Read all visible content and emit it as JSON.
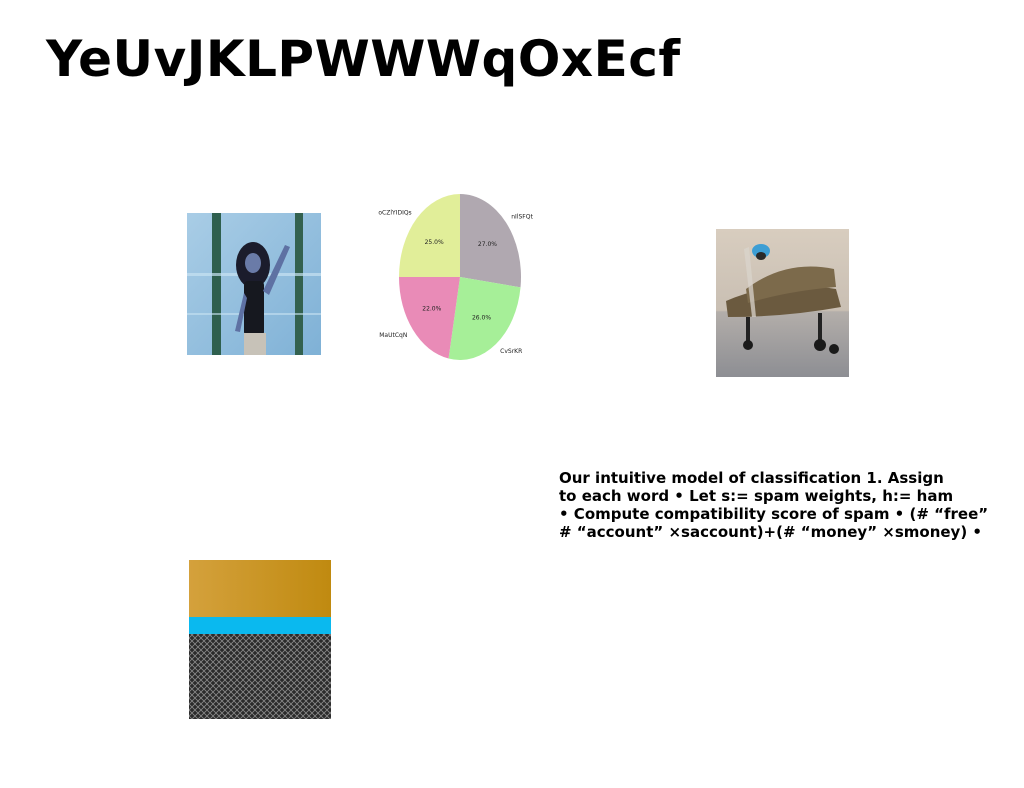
{
  "slide": {
    "title": "YeUvJKLPWWWqOxEcf",
    "text_lines": [
      "Our intuitive model of classification 1. Assign",
      "to each word • Let s:= spam weights, h:= ham",
      "• Compute compatibility score of spam • (# “free”",
      "# “account” ×saccount)+(# “money” ×smoney) •"
    ]
  },
  "images": [
    {
      "subject": "woman-photo"
    },
    {
      "subject": "airplane-photo"
    },
    {
      "subject": "texture-photo"
    }
  ],
  "chart_data": {
    "type": "pie",
    "title": "",
    "slices": [
      {
        "label": "nIlSFQt",
        "value": 27.0,
        "pct_label": "27.0%",
        "color": "#b0a8b0"
      },
      {
        "label": "CvSrKR",
        "value": 26.0,
        "pct_label": "26.0%",
        "color": "#a6ef98"
      },
      {
        "label": "MaUtCqN",
        "value": 22.0,
        "pct_label": "22.0%",
        "color": "#e98bb7"
      },
      {
        "label": "oCZlYIDIQs",
        "value": 25.0,
        "pct_label": "25.0%",
        "color": "#e1ee99"
      }
    ],
    "start_angle": "top",
    "direction": "clockwise",
    "legend": "none"
  }
}
